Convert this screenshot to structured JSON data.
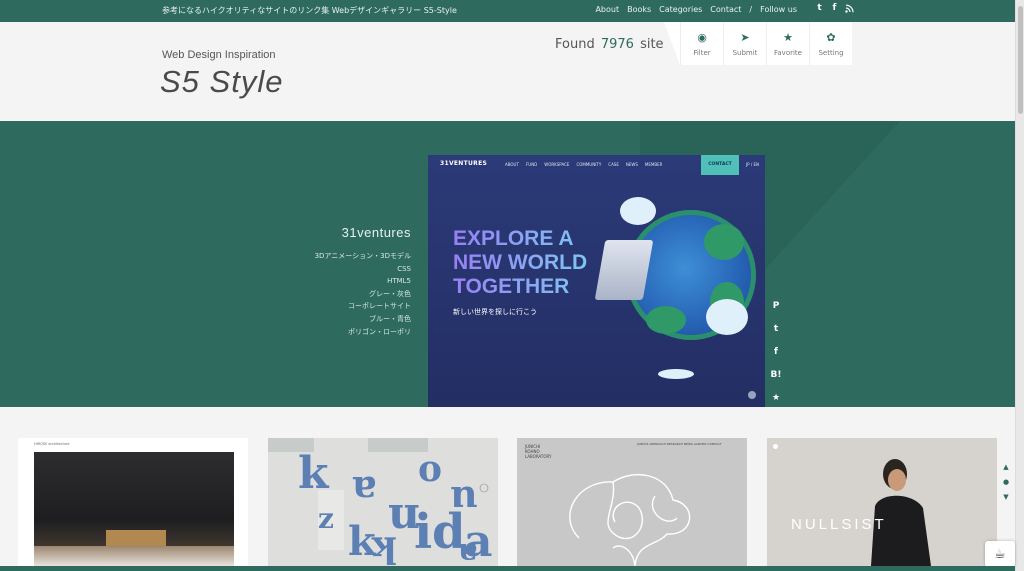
{
  "topbar": {
    "tagline": "参考になるハイクオリティなサイトのリンク集 Webデザインギャラリー S5-Style",
    "nav": [
      "About",
      "Books",
      "Categories",
      "Contact",
      "/",
      "Follow us"
    ],
    "social_icons": [
      "twitter-icon",
      "facebook-icon",
      "rss-icon"
    ]
  },
  "header": {
    "subtitle": "Web Design Inspiration",
    "brand": "S5 Style",
    "found_prefix": "Found",
    "found_count": "7976",
    "found_suffix": "site"
  },
  "tools": [
    {
      "icon": "eye-icon",
      "glyph": "◉",
      "label": "Filter"
    },
    {
      "icon": "send-icon",
      "glyph": "➤",
      "label": "Submit"
    },
    {
      "icon": "star-icon",
      "glyph": "★",
      "label": "Favorite"
    },
    {
      "icon": "gear-icon",
      "glyph": "✿",
      "label": "Setting"
    }
  ],
  "hero": {
    "site_name": "31ventures",
    "tags": [
      "3Dアニメーション・3Dモデル",
      "CSS",
      "HTML5",
      "グレー・灰色",
      "コーポレートサイト",
      "ブルー・青色",
      "ポリゴン・ローポリ"
    ],
    "preview": {
      "logo": "31VENTURES",
      "links": [
        "ABOUT",
        "FUND",
        "WORKSPACE",
        "COMMUNITY",
        "CASE",
        "NEWS",
        "MEMBER"
      ],
      "contact": "CONTACT",
      "lang": "JP / EN",
      "headline": [
        "EXPLORE A",
        "NEW WORLD",
        "TOGETHER"
      ],
      "subline": "新しい世界を探しに行こう"
    },
    "share": [
      {
        "icon": "pinterest-icon",
        "glyph": "P"
      },
      {
        "icon": "twitter-icon",
        "glyph": "t"
      },
      {
        "icon": "facebook-icon",
        "glyph": "f"
      },
      {
        "icon": "hatena-bookmark-icon",
        "glyph": "B!"
      },
      {
        "icon": "star-icon",
        "glyph": "★"
      }
    ]
  },
  "cards": [
    {
      "small": "HIROSE architecture"
    },
    {
      "letters": [
        "k",
        "a",
        "o",
        "n",
        "u",
        "k",
        "i",
        "d",
        "a",
        "z",
        "k",
        "a"
      ]
    },
    {
      "logo": [
        "JUNICHI",
        "KOHNO",
        "LABORATORY"
      ],
      "links": [
        "JUNICHI",
        "APPROACH",
        "RESEARCH",
        "NEWS",
        "ALBUMS",
        "CONTACT"
      ]
    },
    {
      "wordmark": "NULLSIST"
    }
  ],
  "rail": [
    {
      "icon": "arrow-up-icon",
      "glyph": "▲"
    },
    {
      "icon": "dot-icon",
      "glyph": "●"
    },
    {
      "icon": "arrow-down-icon",
      "glyph": "▼"
    }
  ],
  "colors": {
    "accent": "#2e6b5e",
    "background": "#f4f4f4"
  }
}
